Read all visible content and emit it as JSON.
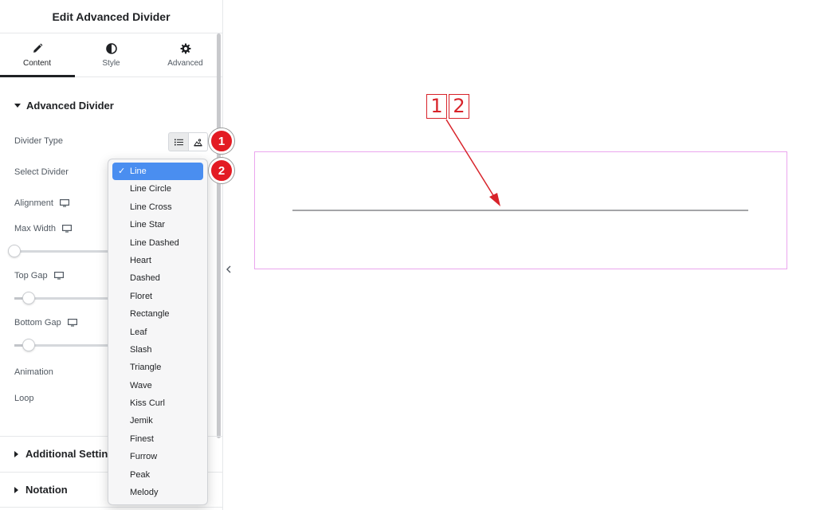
{
  "panel": {
    "title": "Edit Advanced Divider",
    "tabs": [
      {
        "label": "Content",
        "icon": "pencil-icon",
        "active": true
      },
      {
        "label": "Style",
        "icon": "half-circle-icon",
        "active": false
      },
      {
        "label": "Advanced",
        "icon": "gear-icon",
        "active": false
      }
    ],
    "section": {
      "title": "Advanced Divider",
      "expanded": true
    },
    "controls": {
      "divider_type": {
        "label": "Divider Type",
        "options": [
          "list-icon",
          "image-icon"
        ],
        "selected": "list-icon"
      },
      "select_divider": {
        "label": "Select Divider"
      },
      "alignment": {
        "label": "Alignment",
        "icon": "monitor-icon"
      },
      "max_width": {
        "label": "Max Width",
        "icon": "monitor-icon",
        "value": 0
      },
      "top_gap": {
        "label": "Top Gap",
        "icon": "monitor-icon",
        "value": 0.15
      },
      "bottom_gap": {
        "label": "Bottom Gap",
        "icon": "monitor-icon",
        "value": 0.15
      },
      "animation": {
        "label": "Animation"
      },
      "loop": {
        "label": "Loop"
      }
    },
    "collapsed_sections": [
      {
        "title": "Additional Setting"
      },
      {
        "title": "Notation"
      }
    ]
  },
  "dropdown": {
    "selected": "Line",
    "options": [
      "Line",
      "Line Circle",
      "Line Cross",
      "Line Star",
      "Line Dashed",
      "Heart",
      "Dashed",
      "Floret",
      "Rectangle",
      "Leaf",
      "Slash",
      "Triangle",
      "Wave",
      "Kiss Curl",
      "Jemik",
      "Finest",
      "Furrow",
      "Peak",
      "Melody"
    ]
  },
  "markers": [
    "1",
    "2"
  ],
  "callout": {
    "labels": [
      "1",
      "2"
    ]
  },
  "colors": {
    "accent": "#e31b23",
    "selection": "#4a8ef0",
    "frame": "#eaa6ee",
    "divider": "#a4a5a8"
  }
}
